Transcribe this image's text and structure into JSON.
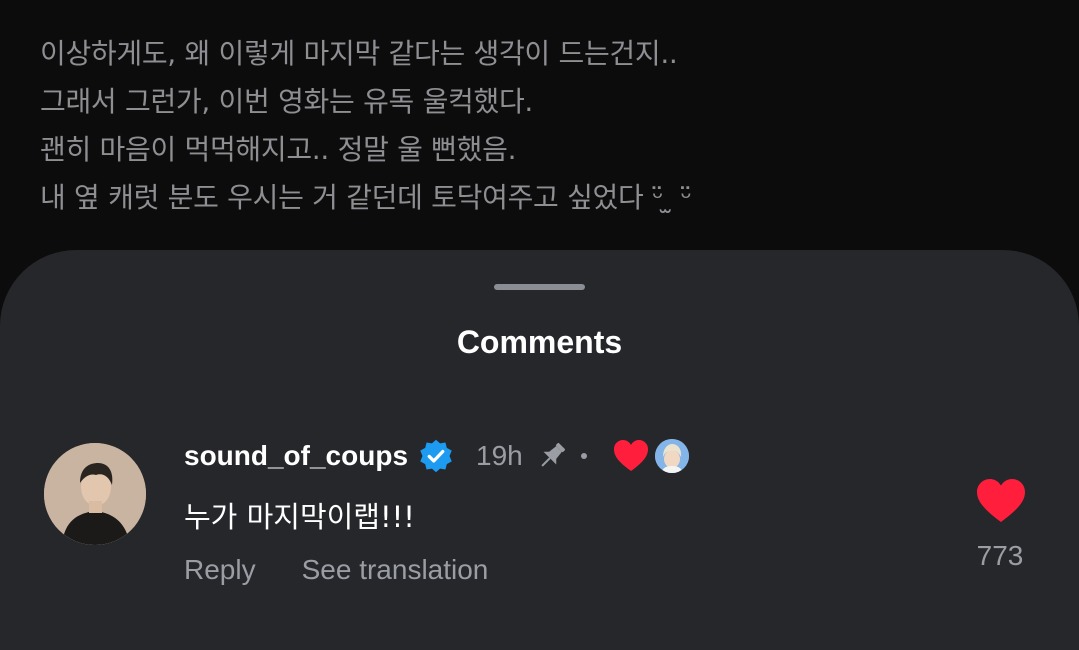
{
  "caption": {
    "lines": [
      "이상하게도, 왜 이렇게 마지막 같다는 생각이 드는건지..",
      "그래서 그런가, 이번 영화는 유독 울컥했다.",
      "괜히 마음이 먹먹해지고.. 정말 울 뻔했음.",
      "내 옆 캐럿 분도 우시는 거 같던데 토닥여주고 싶었다 ᵕ̈ ̫ ᵕ̈"
    ]
  },
  "sheet": {
    "title": "Comments"
  },
  "comment": {
    "username": "sound_of_coups",
    "verified": true,
    "time": "19h",
    "pinned": true,
    "text": "누가 마지막이랩!!!",
    "reply_label": "Reply",
    "translate_label": "See translation",
    "like_count": "773",
    "icons": {
      "verified": "verified-badge-icon",
      "pin": "pin-icon",
      "creator_like": "heart-icon",
      "like": "heart-icon"
    }
  },
  "colors": {
    "background": "#0c0c0d",
    "sheet": "#25272b",
    "heart": "#ff1f3d",
    "verified": "#1d9bf0",
    "muted_text": "#9a9da3"
  }
}
